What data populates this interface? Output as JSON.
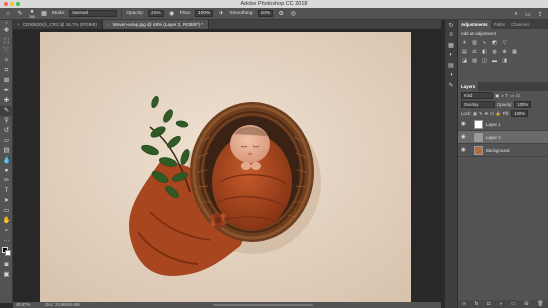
{
  "window": {
    "title": "Adobe Photoshop CC 2018"
  },
  "options_bar": {
    "brush_size": "285",
    "mode_label": "Mode:",
    "mode_value": "Normal",
    "opacity_label": "Opacity:",
    "opacity_value": "21%",
    "flow_label": "Flow:",
    "flow_value": "100%",
    "smoothing_label": "Smoothing:",
    "smoothing_value": "10%"
  },
  "doc_tabs": [
    {
      "label": "CD93930@_CR2 @ 16.7% (RGB/8)"
    },
    {
      "label": "Woven-wrap.jpg @ 48% (Layer 2, RGB/8*) *"
    }
  ],
  "status_bar": {
    "zoom": "48.07%",
    "doc_info": "Doc: 33.9M/49.6M"
  },
  "adjustments": {
    "tabs": [
      "Adjustments",
      "Paths",
      "Channels"
    ],
    "add_label": "Add an adjustment"
  },
  "layers_panel": {
    "tabs": [
      "Layers"
    ],
    "kind_value": "Kind",
    "blend_value": "Overlay",
    "opacity_label": "Opacity:",
    "opacity_value": "100%",
    "lock_label": "Lock:",
    "fill_label": "Fill:",
    "fill_value": "100%",
    "layers": [
      {
        "name": "Layer 1",
        "selected": false
      },
      {
        "name": "Layer 2",
        "selected": true
      },
      {
        "name": "Background",
        "selected": false
      }
    ]
  },
  "colors": {
    "ui_dark": "#535353",
    "canvas_backdrop": "#e7d6c4",
    "wrap_rust": "#a8461f",
    "basket_brown": "#6e3e1f",
    "leaf_green": "#2f5a25"
  }
}
